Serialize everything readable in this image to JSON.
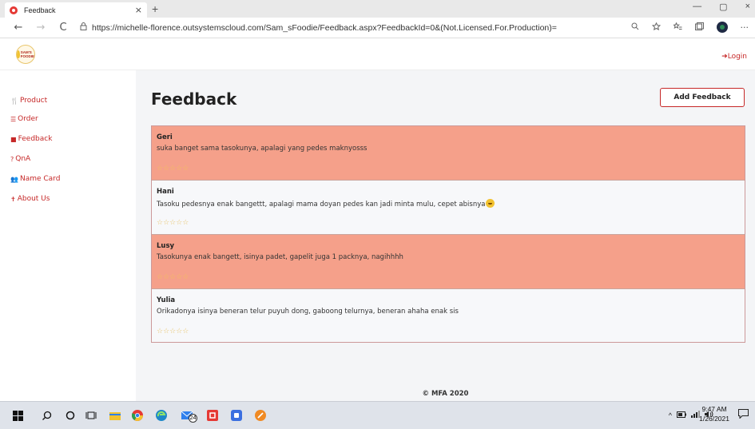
{
  "browser": {
    "tab_title": "Feedback",
    "tab_close": "×",
    "new_tab": "+",
    "win_min": "—",
    "win_max": "▢",
    "win_close": "×",
    "url": "https://michelle-florence.outsystemscloud.com/Sam_sFoodie/Feedback.aspx?FeedbackId=0&(Not.Licensed.For.Production)=",
    "back": "←",
    "forward": "→",
    "reload": "C",
    "more": "···"
  },
  "app": {
    "logo_text_1": "SAM'S",
    "logo_text_2": "FOODIE",
    "login_label": "Login",
    "accent_color": "#c62828"
  },
  "sidebar": {
    "items": [
      {
        "icon": "product-icon",
        "glyph": "🍴",
        "label": "Product"
      },
      {
        "icon": "order-icon",
        "glyph": "☰",
        "label": "Order"
      },
      {
        "icon": "feedback-icon",
        "glyph": "■",
        "label": "Feedback"
      },
      {
        "icon": "question-icon",
        "glyph": "?",
        "label": "QnA"
      },
      {
        "icon": "people-icon",
        "glyph": "👥",
        "label": "Name Card"
      },
      {
        "icon": "person-icon",
        "glyph": "✝",
        "label": "About Us"
      }
    ]
  },
  "main": {
    "title": "Feedback",
    "add_button": "Add Feedback",
    "feedback": [
      {
        "name": "Geri",
        "message": "suka banget sama tasokunya, apalagi yang pedes maknyosss",
        "rating": 0,
        "highlight": true
      },
      {
        "name": "Hani",
        "message": "Tasoku pedesnya enak bangettt, apalagi mama doyan pedes kan jadi minta mulu, cepet abisnya",
        "rating": 0,
        "highlight": false,
        "emoji": "grin-emoji"
      },
      {
        "name": "Lusy",
        "message": "Tasokunya enak bangett, isinya padet, gapelit juga 1 packnya, nagihhhh",
        "rating": 0,
        "highlight": true
      },
      {
        "name": "Yulia",
        "message": "Orikadonya isinya beneran telur puyuh dong, gaboong telurnya, beneran ahaha enak sis",
        "rating": 0,
        "highlight": false
      }
    ],
    "stars": "☆☆☆☆☆",
    "highlight_color": "#f5a08a"
  },
  "footer": {
    "text": "© MFA 2020"
  },
  "taskbar": {
    "time": "9:47 AM",
    "date": "1/26/2021",
    "badge": "24"
  }
}
